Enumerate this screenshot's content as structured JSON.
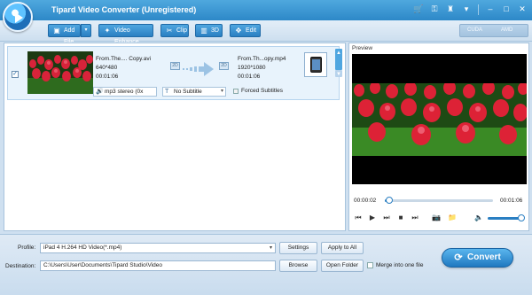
{
  "app": {
    "title": "Tipard Video Converter (Unregistered)"
  },
  "window_controls": {
    "cart_icon": "🛒",
    "key_icon": "⚿",
    "gift_icon": "♜",
    "menu_icon": "▾",
    "minimize_icon": "–",
    "maximize_icon": "□",
    "close_icon": "✕"
  },
  "toolbar": {
    "add_file": "Add File",
    "video_enhance": "Video Enhance",
    "clip": "Clip",
    "three_d": "3D",
    "edit": "Edit",
    "cuda": "CUDA",
    "amd": "AMD",
    "add_icon": "▣",
    "dropdown_arrow": "▾",
    "enhance_icon": "✦",
    "clip_icon": "✂",
    "three_d_icon": "▥",
    "edit_icon": "✥"
  },
  "file_item": {
    "checked": true,
    "check_mark": "✓",
    "source_name": "From.The.... Copy.avi",
    "source_resolution": "640*480",
    "source_duration": "00:01:06",
    "target_name": "From.Th...opy.mp4",
    "target_resolution": "1920*1080",
    "target_duration": "00:01:06",
    "audio_track": "mp3 stereo (0x",
    "audio_icon": "🔊",
    "subtitle": "No Subtitle",
    "subtitle_icon": "T",
    "forced_subtitles": "Forced Subtitles",
    "badge_2d_src": "2D",
    "badge_2d_dst": "2D",
    "arrow_icon": "⇒",
    "scroll_up": "▲",
    "scroll_down": "▼"
  },
  "preview": {
    "label": "Preview",
    "current_time": "00:00:02",
    "total_time": "00:01:06",
    "progress": 0.03,
    "volume": 1.0,
    "prev_icon": "⏮",
    "play_icon": "▶",
    "next_icon": "⏭",
    "stop_icon": "■",
    "end_icon": "⏭",
    "snapshot_icon": "📷",
    "folder_icon": "📁",
    "volume_icon": "🔈"
  },
  "bottom": {
    "profile_label": "Profile:",
    "profile_value": "iPad 4 H.264 HD Video(*.mp4)",
    "settings": "Settings",
    "apply_to_all": "Apply to All",
    "destination_label": "Destination:",
    "destination_value": "C:\\Users\\User\\Documents\\Tipard Studio\\Video",
    "browse": "Browse",
    "open_folder": "Open Folder",
    "merge_label": "Merge into one file",
    "convert": "Convert",
    "convert_icon": "⟳",
    "dropdown_arrow": "▾"
  }
}
